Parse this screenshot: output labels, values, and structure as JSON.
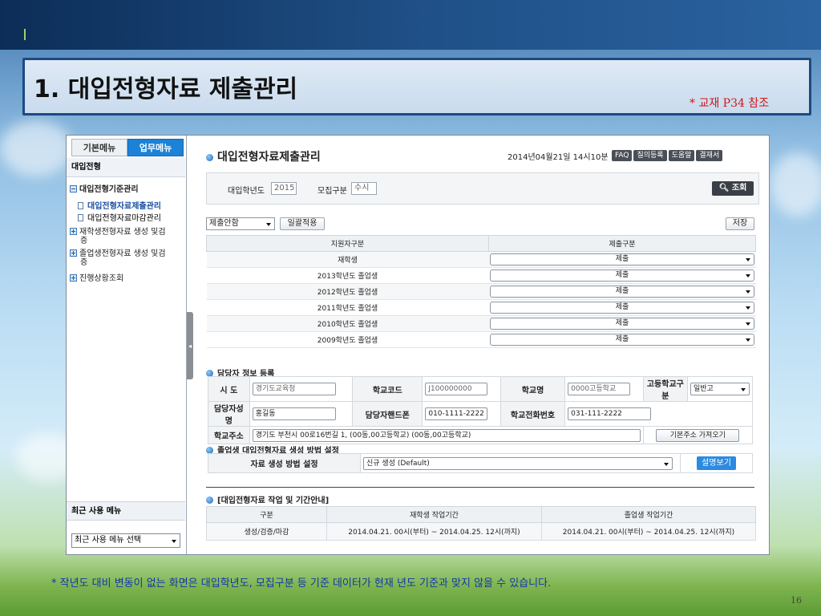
{
  "slide": {
    "title": "1. 대입전형자료 제출관리",
    "ref_note": "* 교재 P34 참조",
    "footnote": "* 작년도 대비 변동이 없는 화면은 대입학년도, 모집구분 등 기준 데이터가 현재 년도 기준과 맞지 않을 수 있습니다.",
    "page_number": "16"
  },
  "left_panel": {
    "tab_basic": "기본메뉴",
    "tab_work": "업무메뉴",
    "section": "대입전형",
    "group": "대입전형기준관리",
    "sub_items": [
      "대입전형자료제출관리",
      "대입전형자료마감관리"
    ],
    "items": [
      {
        "line1": "재학생전형자료 생성 및검",
        "line2": "증"
      },
      {
        "line1": "졸업생전형자료 생성 및검",
        "line2": "증"
      },
      {
        "line1": "진행상황조회",
        "line2": ""
      }
    ],
    "recent_title": "최근 사용 메뉴",
    "recent_select": "최근 사용 메뉴 선택"
  },
  "content": {
    "title": "대입전형자료제출관리",
    "datetime": "2014년04월21일 14시10분",
    "tool_buttons": [
      "FAQ",
      "질의등록",
      "도움말",
      "결재서"
    ],
    "search": {
      "year_label": "대입학년도",
      "year_value": "2015",
      "type_label": "모집구분",
      "type_value": "수시",
      "button": "조회"
    },
    "bulk": {
      "select_value": "제출안함",
      "apply_button": "일괄적용",
      "save_button": "저장"
    },
    "grid": {
      "headers": [
        "지원자구분",
        "제출구분"
      ],
      "rows": [
        {
          "category": "재학생",
          "status": "제출"
        },
        {
          "category": "2013학년도 졸업생",
          "status": "제출"
        },
        {
          "category": "2012학년도 졸업생",
          "status": "제출"
        },
        {
          "category": "2011학년도 졸업생",
          "status": "제출"
        },
        {
          "category": "2010학년도 졸업생",
          "status": "제출"
        },
        {
          "category": "2009학년도 졸업생",
          "status": "제출"
        }
      ]
    },
    "manager": {
      "section_title": "담당자 정보 등록",
      "region_label": "시 도",
      "region_value": "경기도교육청",
      "school_code_label": "학교코드",
      "school_code_value": "J100000000",
      "school_name_label": "학교명",
      "school_name_value": "0000고등학교",
      "school_type_label": "고등학교구분",
      "school_type_value": "일반고",
      "name_label": "담당자성명",
      "name_value": "홍길동",
      "phone_label": "담당자핸드폰",
      "phone_value": "010-1111-2222",
      "school_phone_label": "학교전화번호",
      "school_phone_value": "031-111-2222",
      "address_label": "학교주소",
      "address_value": "경기도 부천시 00로16번길 1, (00동,00고등학교) (00동,00고등학교)",
      "address_button": "기본주소 가져오기"
    },
    "generation": {
      "section_title": "졸업생 대입전형자료 생성 방법 설정",
      "label": "자료 생성 방법 설정",
      "value": "신규 생성 (Default)",
      "button": "설명보기"
    },
    "period": {
      "section_title": "[대입전형자료 작업 및 기간안내]",
      "headers": [
        "구분",
        "재학생 작업기간",
        "졸업생 작업기간"
      ],
      "row": [
        "생성/검증/마감",
        "2014.04.21. 00시(부터) ~ 2014.04.25. 12시(까지)",
        "2014.04.21. 00시(부터) ~ 2014.04.25. 12시(까지)"
      ]
    }
  }
}
